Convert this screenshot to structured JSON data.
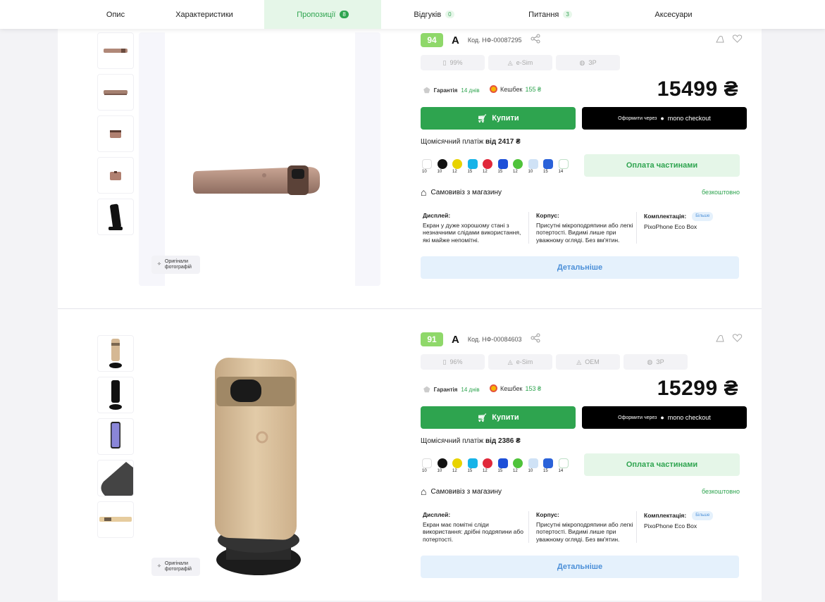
{
  "tabs": [
    {
      "label": "Опис",
      "count": ""
    },
    {
      "label": "Характеристики",
      "count": ""
    },
    {
      "label": "Пропозиції",
      "count": "8"
    },
    {
      "label": "Відгуків",
      "count": "0"
    },
    {
      "label": "Питання",
      "count": "3"
    },
    {
      "label": "Аксесуари",
      "count": ""
    }
  ],
  "offers": [
    {
      "score": "94",
      "grade": "A",
      "code": "Код. НФ-00087295",
      "chips": [
        "99%",
        "e-Sim",
        "ЗР"
      ],
      "guarantee_label": "Гарантія",
      "guarantee_value": "14 днів",
      "cashback_label": "Кешбек",
      "cashback_value": "155 ₴",
      "price": "15499 ₴",
      "buy_label": "Купити",
      "mono_prefix": "Оформити через",
      "mono_label": "mono checkout",
      "monthly_label": "Щомісячний платіж",
      "monthly_value": "від 2417 ₴",
      "bank_months": [
        "10",
        "10",
        "12",
        "15",
        "12",
        "15",
        "12",
        "10",
        "15",
        "14"
      ],
      "partial_label": "Оплата частинами",
      "pickup_label": "Самовивіз з магазину",
      "pickup_price": "безкоштовно",
      "display_title": "Дисплей:",
      "display_text": "Екран у дуже хорошому стані з незначними слідами використання, які майже непомітні.",
      "body_title": "Корпус:",
      "body_text": "Присутні мікроподряпини або легкі потертості. Видимі лише при уважному огляді. Без вм'ятин.",
      "kit_title": "Комплектація:",
      "kit_more": "Більше",
      "kit_text": "PixoPhone Eco Box",
      "details_label": "Детальніше",
      "orig_photos": "Оригінали фотографій"
    },
    {
      "score": "91",
      "grade": "A",
      "code": "Код. НФ-00084603",
      "chips": [
        "96%",
        "e-Sim",
        "OEM",
        "ЗР"
      ],
      "guarantee_label": "Гарантія",
      "guarantee_value": "14 днів",
      "cashback_label": "Кешбек",
      "cashback_value": "153 ₴",
      "price": "15299 ₴",
      "buy_label": "Купити",
      "mono_prefix": "Оформити через",
      "mono_label": "mono checkout",
      "monthly_label": "Щомісячний платіж",
      "monthly_value": "від 2386 ₴",
      "bank_months": [
        "10",
        "10",
        "12",
        "15",
        "12",
        "15",
        "12",
        "10",
        "15",
        "14"
      ],
      "partial_label": "Оплата частинами",
      "pickup_label": "Самовивіз з магазину",
      "pickup_price": "безкоштовно",
      "display_title": "Дисплей:",
      "display_text": "Екран має помітні сліди використання: дрібні подряпини або потертості.",
      "body_title": "Корпус:",
      "body_text": "Присутні мікроподряпини або легкі потертості. Видимі лише при уважному огляді. Без вм'ятин.",
      "kit_title": "Комплектація:",
      "kit_more": "Більше",
      "kit_text": "PixoPhone Eco Box",
      "details_label": "Детальніше",
      "orig_photos": "Оригінали фотографій"
    }
  ],
  "colors": {
    "accent": "#2ea44f",
    "accent_light": "#e5f6e8",
    "score": "#8fd86a",
    "blue_light": "#e5f1fc",
    "blue": "#4b8fd8"
  }
}
